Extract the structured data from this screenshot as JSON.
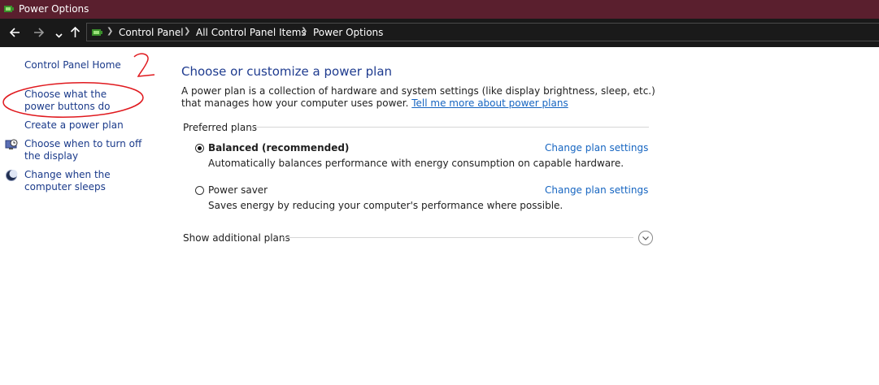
{
  "window": {
    "title": "Power Options"
  },
  "breadcrumb": [
    "Control Panel",
    "All Control Panel Items",
    "Power Options"
  ],
  "nav": {
    "back": "back-arrow-icon",
    "forward": "forward-arrow-icon",
    "recent": "chevron-down-icon",
    "up": "up-arrow-icon"
  },
  "sidebar": {
    "home": "Control Panel Home",
    "links": [
      {
        "label": "Choose what the power buttons do"
      },
      {
        "label": "Create a power plan"
      },
      {
        "label": "Choose when to turn off the display",
        "icon": "monitor-clock-icon"
      },
      {
        "label": "Change when the computer sleeps",
        "icon": "moon-icon"
      }
    ]
  },
  "main": {
    "heading": "Choose or customize a power plan",
    "description": "A power plan is a collection of hardware and system settings (like display brightness, sleep, etc.) that manages how your computer uses power.",
    "learn_more": "Tell me more about power plans",
    "group_label": "Preferred plans",
    "plans": [
      {
        "name": "Balanced (recommended)",
        "selected": true,
        "description": "Automatically balances performance with energy consumption on capable hardware.",
        "link": "Change plan settings"
      },
      {
        "name": "Power saver",
        "selected": false,
        "description": "Saves energy by reducing your computer's performance where possible.",
        "link": "Change plan settings"
      }
    ],
    "show_more": "Show additional plans"
  },
  "annotation": {
    "text": "2",
    "color": "#e0191e"
  }
}
